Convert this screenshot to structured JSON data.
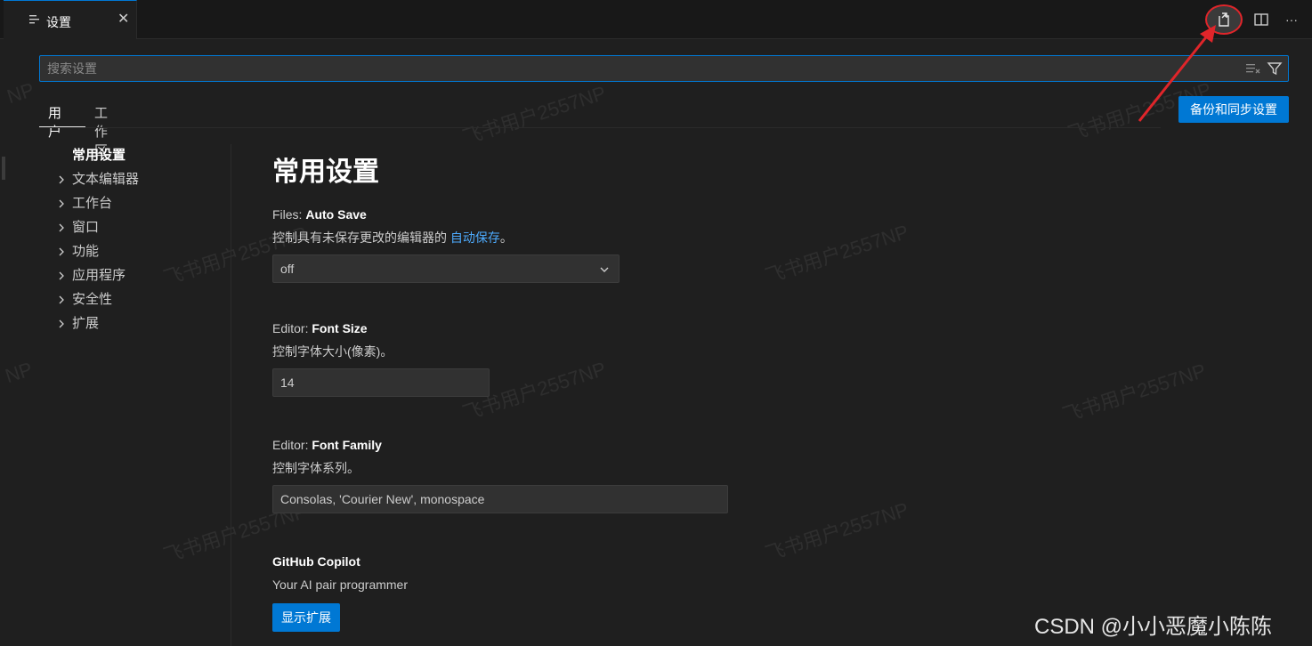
{
  "tab": {
    "label": "设置",
    "close": "✕"
  },
  "header_actions": {
    "open_json_icon": "open-settings-json-icon",
    "split_icon": "split-editor-icon",
    "more": "···"
  },
  "search": {
    "placeholder": "搜索设置",
    "value": ""
  },
  "scope_tabs": [
    {
      "label": "用户",
      "active": true
    },
    {
      "label": "工作区",
      "active": false
    }
  ],
  "backup_button": "备份和同步设置",
  "toc": [
    {
      "label": "常用设置",
      "expandable": false
    },
    {
      "label": "文本编辑器",
      "expandable": true
    },
    {
      "label": "工作台",
      "expandable": true
    },
    {
      "label": "窗口",
      "expandable": true
    },
    {
      "label": "功能",
      "expandable": true
    },
    {
      "label": "应用程序",
      "expandable": true
    },
    {
      "label": "安全性",
      "expandable": true
    },
    {
      "label": "扩展",
      "expandable": true
    }
  ],
  "main": {
    "title": "常用设置",
    "auto_save": {
      "category": "Files: ",
      "name": "Auto Save",
      "desc_prefix": "控制具有未保存更改的编辑器的 ",
      "desc_link": "自动保存",
      "desc_suffix": "。",
      "value": "off"
    },
    "font_size": {
      "category": "Editor: ",
      "name": "Font Size",
      "desc": "控制字体大小(像素)。",
      "value": "14"
    },
    "font_family": {
      "category": "Editor: ",
      "name": "Font Family",
      "desc": "控制字体系列。",
      "value": "Consolas, 'Courier New', monospace"
    },
    "copilot": {
      "name": "GitHub Copilot",
      "desc": "Your AI pair programmer",
      "button": "显示扩展"
    }
  },
  "watermark": "飞书用户2557NP",
  "watermark_partial": "NP",
  "credit": "CSDN @小小恶魔小陈陈",
  "colors": {
    "accent": "#0078d4",
    "link": "#4daafc",
    "annotation": "#e0252a"
  }
}
